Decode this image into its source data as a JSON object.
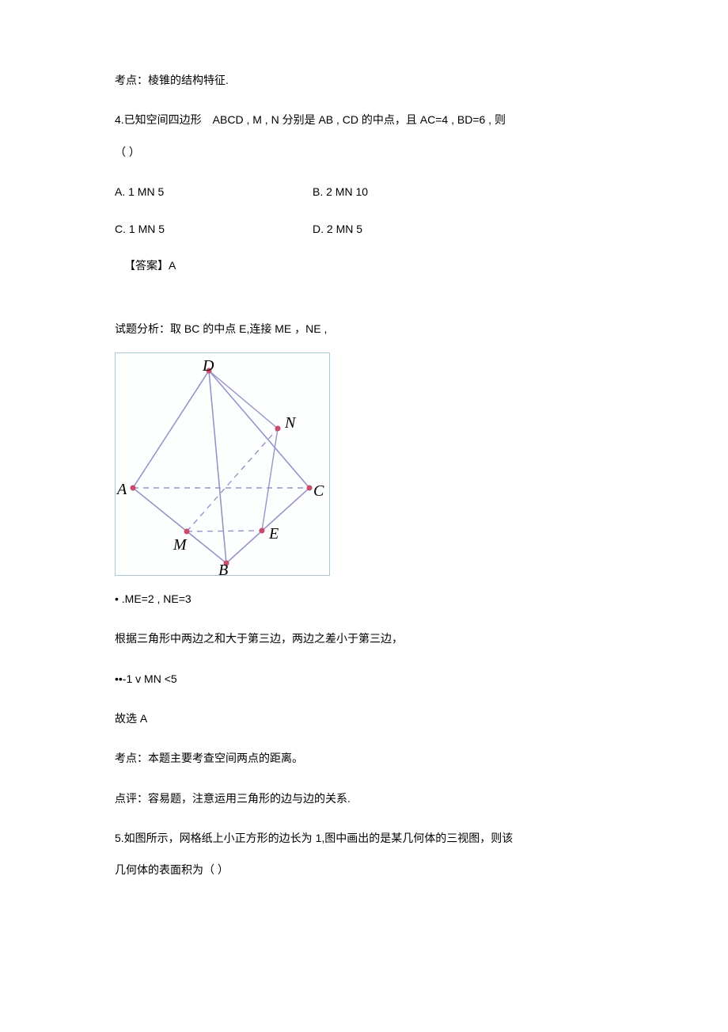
{
  "topic_prev": "考点：棱锥的结构特征.",
  "q4": {
    "stem_line1": "4.已知空间四边形 ABCD , M , N 分别是  AB , CD 的中点，且  AC=4 , BD=6 , 则",
    "stem_line2": "（ ）",
    "optA": "A.  1 MN 5",
    "optB": "B.  2 MN 10",
    "optC": "C.   1 MN 5",
    "optD": "D.   2 MN 5",
    "answer": "【答案】A",
    "analysis_intro": "试题分析：取  BC 的中点 E,连接 ME ，NE ,",
    "me_ne": "• .ME=2 , NE=3",
    "tri_rule": "根据三角形中两边之和大于第三边，两边之差小于第三边，",
    "range": "••-1 v MN <5",
    "conclude": "故选 A",
    "topic": "考点：本题主要考查空间两点的距离。",
    "comment": "点评：容易题，注意运用三角形的边与边的关系."
  },
  "q5": {
    "stem_line1": "5.如图所示，网格纸上小正方形的边长为 1,图中画出的是某几何体的三视图，则该",
    "stem_line2": "几何体的表面积为（ ）"
  },
  "labels": {
    "D": "D",
    "N": "N",
    "A": "A",
    "C": "C",
    "M": "M",
    "E": "E",
    "B": "B"
  }
}
